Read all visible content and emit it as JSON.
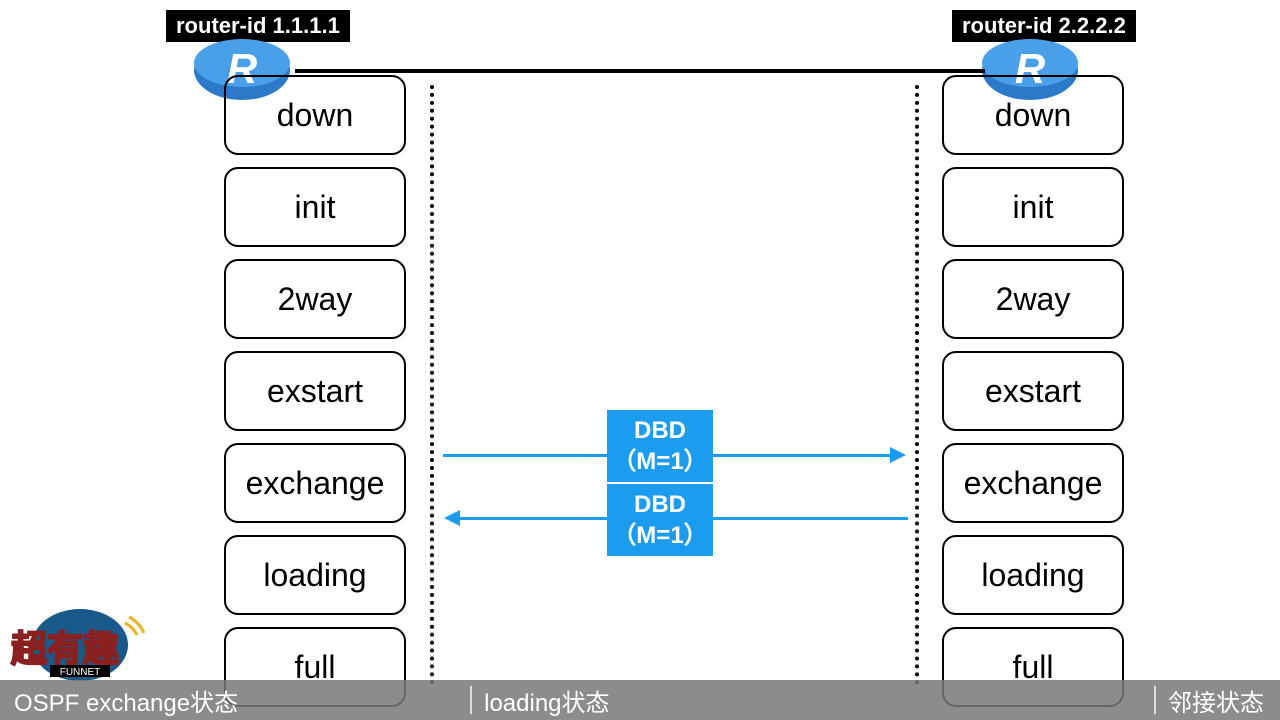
{
  "router1": {
    "label": "router-id 1.1.1.1"
  },
  "router2": {
    "label": "router-id 2.2.2.2"
  },
  "states": [
    "down",
    "init",
    "2way",
    "exstart",
    "exchange",
    "loading",
    "full"
  ],
  "packets": {
    "top": {
      "line1": "DBD",
      "line2": "（M=1）"
    },
    "bottom": {
      "line1": "DBD",
      "line2": "（M=1）"
    }
  },
  "bottomBar": {
    "item1": "OSPF exchange状态",
    "item2": "loading状态",
    "item3": "邻接状态"
  },
  "logoText": "超有趣",
  "logoSub": "FUNNET"
}
